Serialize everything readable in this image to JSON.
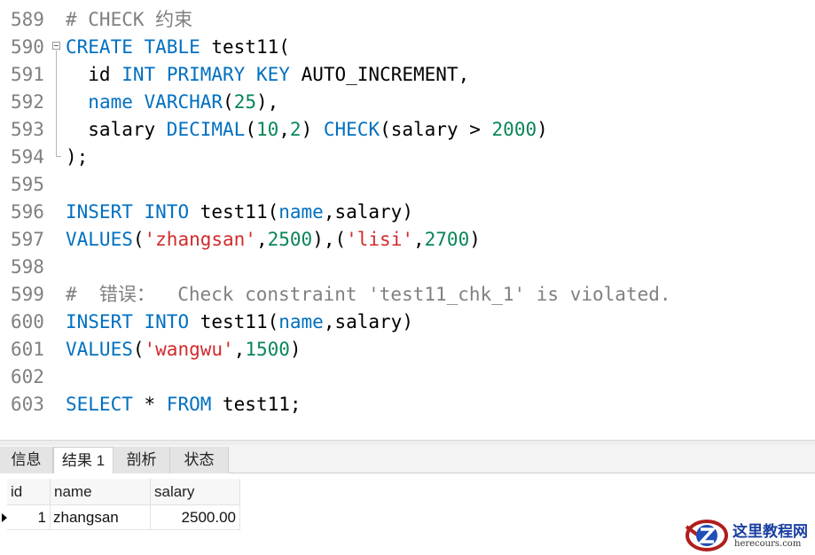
{
  "editor": {
    "lines": [
      {
        "num": "589",
        "tokens": [
          {
            "t": "# CHECK 约束",
            "c": "c"
          }
        ]
      },
      {
        "num": "590",
        "tokens": [
          {
            "t": "CREATE",
            "c": "k"
          },
          {
            "t": " ",
            "c": ""
          },
          {
            "t": "TABLE",
            "c": "k"
          },
          {
            "t": " test11(",
            "c": ""
          }
        ]
      },
      {
        "num": "591",
        "tokens": [
          {
            "t": "  id ",
            "c": ""
          },
          {
            "t": "INT",
            "c": "k"
          },
          {
            "t": " ",
            "c": ""
          },
          {
            "t": "PRIMARY",
            "c": "k"
          },
          {
            "t": " ",
            "c": ""
          },
          {
            "t": "KEY",
            "c": "k"
          },
          {
            "t": " AUTO_INCREMENT,",
            "c": ""
          }
        ]
      },
      {
        "num": "592",
        "tokens": [
          {
            "t": "  ",
            "c": ""
          },
          {
            "t": "name",
            "c": "k"
          },
          {
            "t": " ",
            "c": ""
          },
          {
            "t": "VARCHAR",
            "c": "k"
          },
          {
            "t": "(",
            "c": ""
          },
          {
            "t": "25",
            "c": "n"
          },
          {
            "t": "),",
            "c": ""
          }
        ]
      },
      {
        "num": "593",
        "tokens": [
          {
            "t": "  salary ",
            "c": ""
          },
          {
            "t": "DECIMAL",
            "c": "k"
          },
          {
            "t": "(",
            "c": ""
          },
          {
            "t": "10",
            "c": "n"
          },
          {
            "t": ",",
            "c": ""
          },
          {
            "t": "2",
            "c": "n"
          },
          {
            "t": ") ",
            "c": ""
          },
          {
            "t": "CHECK",
            "c": "k"
          },
          {
            "t": "(salary > ",
            "c": ""
          },
          {
            "t": "2000",
            "c": "n"
          },
          {
            "t": ")",
            "c": ""
          }
        ]
      },
      {
        "num": "594",
        "tokens": [
          {
            "t": ");",
            "c": ""
          }
        ]
      },
      {
        "num": "595",
        "tokens": []
      },
      {
        "num": "596",
        "tokens": [
          {
            "t": "INSERT",
            "c": "k"
          },
          {
            "t": " ",
            "c": ""
          },
          {
            "t": "INTO",
            "c": "k"
          },
          {
            "t": " test11(",
            "c": ""
          },
          {
            "t": "name",
            "c": "k"
          },
          {
            "t": ",salary)",
            "c": ""
          }
        ]
      },
      {
        "num": "597",
        "tokens": [
          {
            "t": "VALUES",
            "c": "k"
          },
          {
            "t": "(",
            "c": ""
          },
          {
            "t": "'zhangsan'",
            "c": "s"
          },
          {
            "t": ",",
            "c": ""
          },
          {
            "t": "2500",
            "c": "n"
          },
          {
            "t": "),(",
            "c": ""
          },
          {
            "t": "'lisi'",
            "c": "s"
          },
          {
            "t": ",",
            "c": ""
          },
          {
            "t": "2700",
            "c": "n"
          },
          {
            "t": ")",
            "c": ""
          }
        ]
      },
      {
        "num": "598",
        "tokens": []
      },
      {
        "num": "599",
        "tokens": [
          {
            "t": "#  错误：  Check constraint 'test11_chk_1' is violated.",
            "c": "c"
          }
        ]
      },
      {
        "num": "600",
        "tokens": [
          {
            "t": "INSERT",
            "c": "k"
          },
          {
            "t": " ",
            "c": ""
          },
          {
            "t": "INTO",
            "c": "k"
          },
          {
            "t": " test11(",
            "c": ""
          },
          {
            "t": "name",
            "c": "k"
          },
          {
            "t": ",salary)",
            "c": ""
          }
        ]
      },
      {
        "num": "601",
        "tokens": [
          {
            "t": "VALUES",
            "c": "k"
          },
          {
            "t": "(",
            "c": ""
          },
          {
            "t": "'wangwu'",
            "c": "s"
          },
          {
            "t": ",",
            "c": ""
          },
          {
            "t": "1500",
            "c": "n"
          },
          {
            "t": ")",
            "c": ""
          }
        ]
      },
      {
        "num": "602",
        "tokens": []
      },
      {
        "num": "603",
        "tokens": [
          {
            "t": "SELECT",
            "c": "k"
          },
          {
            "t": " * ",
            "c": ""
          },
          {
            "t": "FROM",
            "c": "k"
          },
          {
            "t": " test11;",
            "c": ""
          }
        ]
      }
    ]
  },
  "tabs": {
    "info": "信息",
    "result1": "结果 1",
    "analysis": "剖析",
    "status": "状态",
    "active": "result1"
  },
  "result_grid": {
    "columns": [
      "id",
      "name",
      "salary"
    ],
    "rows": [
      [
        "1",
        "zhangsan",
        "2500.00"
      ]
    ]
  },
  "watermark": {
    "title": "这里教程网",
    "url": "herecours.com"
  },
  "colors": {
    "keyword": "#0070c0",
    "number": "#098658",
    "string": "#d12b2b",
    "comment": "#808080",
    "line_number": "#808080"
  }
}
